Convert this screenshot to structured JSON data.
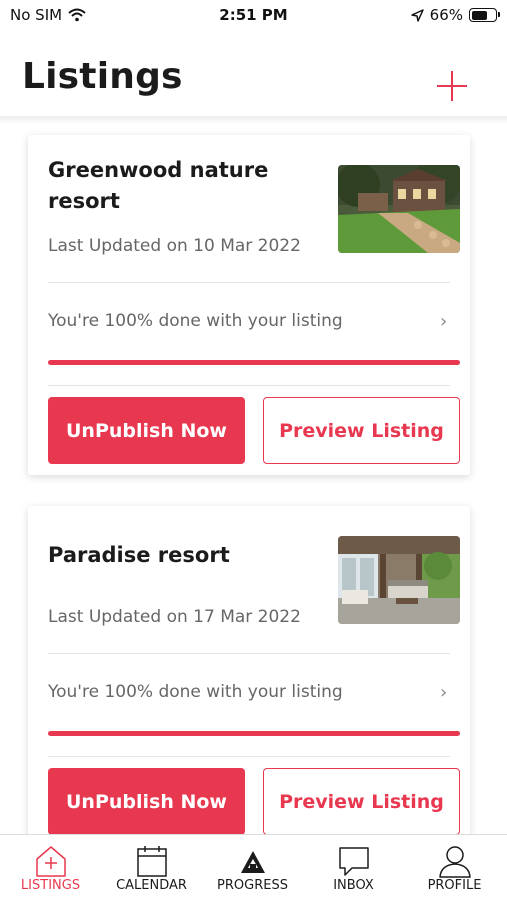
{
  "status_bar": {
    "carrier": "No SIM",
    "time": "2:51 PM",
    "battery": "66%",
    "battery_level": 0.66
  },
  "header": {
    "title": "Listings"
  },
  "colors": {
    "accent": "#e8384f",
    "text": "#1b1b1b",
    "muted": "#666666"
  },
  "listings": [
    {
      "title": "Greenwood nature resort",
      "updated": "Last Updated on 10 Mar 2022",
      "progress_text": "You're 100% done with your listing",
      "progress": 1.0,
      "unpublish_label": "UnPublish Now",
      "preview_label": "Preview Listing",
      "thumb_icon": "resort-garden-photo"
    },
    {
      "title": "Paradise resort",
      "updated": "Last Updated on 17 Mar 2022",
      "progress_text": "You're 100% done with your listing",
      "progress": 1.0,
      "unpublish_label": "UnPublish Now",
      "preview_label": "Preview Listing",
      "thumb_icon": "resort-patio-photo"
    }
  ],
  "tabs": [
    {
      "label": "LISTINGS",
      "icon": "house-plus-icon",
      "active": true
    },
    {
      "label": "CALENDAR",
      "icon": "calendar-icon",
      "active": false
    },
    {
      "label": "PROGRESS",
      "icon": "progress-logo-icon",
      "active": false
    },
    {
      "label": "INBOX",
      "icon": "chat-bubble-icon",
      "active": false
    },
    {
      "label": "PROFILE",
      "icon": "person-icon",
      "active": false
    }
  ]
}
